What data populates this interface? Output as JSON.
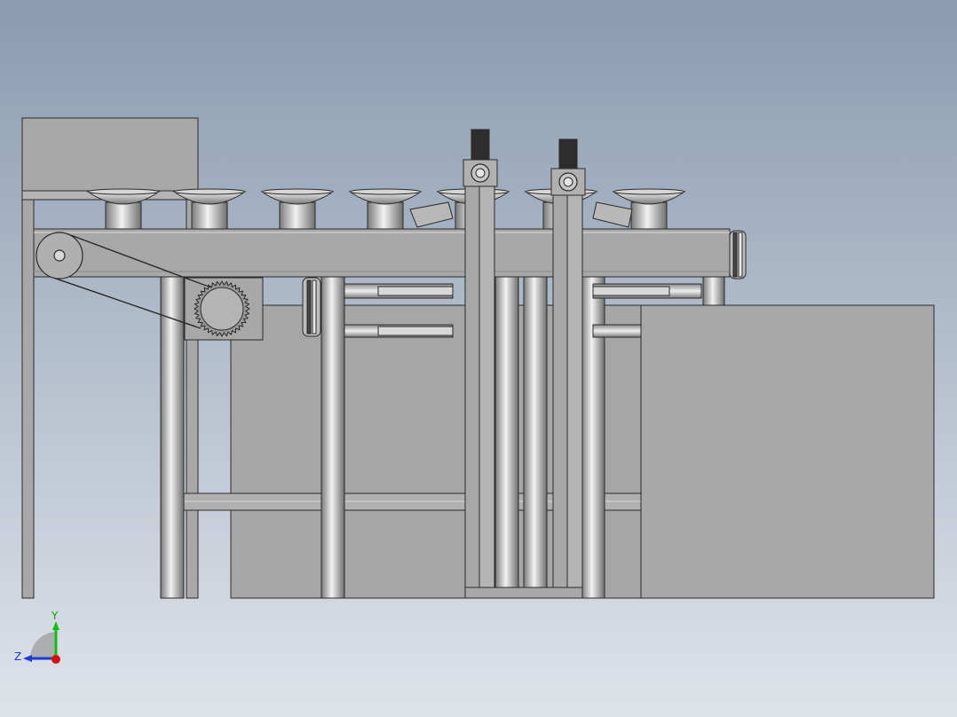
{
  "viewport": {
    "background_top": "#8a9bb0",
    "background_bottom": "#dfe3ea"
  },
  "model": {
    "cup_count": 7,
    "base_cylinder_count": 5,
    "sensor_post_count": 2,
    "colors": {
      "frame": "#a8a8a8",
      "frame_light": "#b8b8b8",
      "edge": "#2a2a2a",
      "steel_dark": "#6e6e6e",
      "steel_light": "#f2f2f2",
      "sensor_head": "#2d2d2d"
    }
  },
  "triad": {
    "y_label": "Y",
    "z_label": "Z",
    "y_color": "#10c010",
    "z_color": "#1a3adc",
    "x_color": "#d81010"
  }
}
